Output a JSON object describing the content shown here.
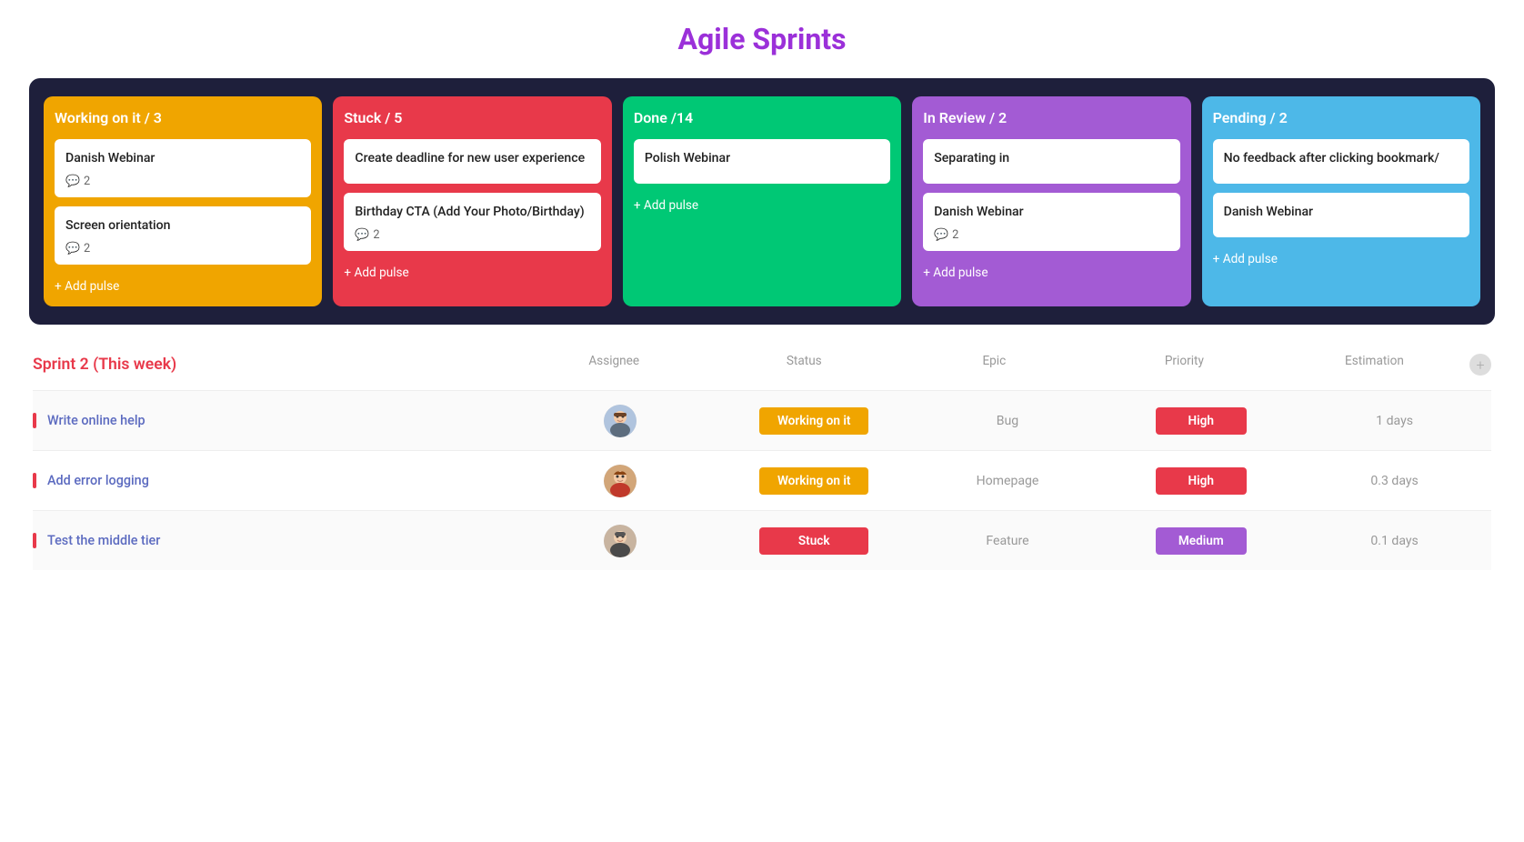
{
  "pageTitle": "Agile Sprints",
  "kanban": {
    "columns": [
      {
        "id": "working-on-it",
        "title": "Working on it / 3",
        "colorClass": "orange",
        "cards": [
          {
            "id": "c1",
            "title": "Danish Webinar",
            "comments": 2
          },
          {
            "id": "c2",
            "title": "Screen orientation",
            "comments": 2
          }
        ],
        "addPulse": "+ Add pulse"
      },
      {
        "id": "stuck",
        "title": "Stuck / 5",
        "colorClass": "red",
        "cards": [
          {
            "id": "c3",
            "title": "Create deadline for new user experience",
            "comments": null
          },
          {
            "id": "c4",
            "title": "Birthday CTA (Add Your Photo/Birthday)",
            "comments": 2
          }
        ],
        "addPulse": "+ Add pulse"
      },
      {
        "id": "done",
        "title": "Done /14",
        "colorClass": "green",
        "cards": [
          {
            "id": "c5",
            "title": "Polish Webinar",
            "comments": null
          }
        ],
        "addPulse": "+ Add pulse"
      },
      {
        "id": "in-review",
        "title": "In Review / 2",
        "colorClass": "purple",
        "cards": [
          {
            "id": "c6",
            "title": "Separating in",
            "comments": null
          },
          {
            "id": "c7",
            "title": "Danish Webinar",
            "comments": 2
          }
        ],
        "addPulse": "+ Add pulse"
      },
      {
        "id": "pending",
        "title": "Pending / 2",
        "colorClass": "blue",
        "cards": [
          {
            "id": "c8",
            "title": "No feedback after clicking bookmark/",
            "comments": null
          },
          {
            "id": "c9",
            "title": "Danish Webinar",
            "comments": null
          }
        ],
        "addPulse": "+ Add pulse"
      }
    ]
  },
  "sprint": {
    "title": "Sprint 2 (This week)",
    "columns": {
      "assignee": "Assignee",
      "status": "Status",
      "epic": "Epic",
      "priority": "Priority",
      "estimation": "Estimation"
    },
    "addIcon": "+",
    "rows": [
      {
        "id": "r1",
        "task": "Write online help",
        "avatarLabel": "avatar-male-1",
        "avatarEmoji": "👨",
        "statusLabel": "Working on it",
        "statusClass": "status-orange",
        "epic": "Bug",
        "priorityLabel": "High",
        "priorityClass": "priority-red",
        "estimation": "1 days"
      },
      {
        "id": "r2",
        "task": "Add error logging",
        "avatarLabel": "avatar-female-1",
        "avatarEmoji": "👩",
        "statusLabel": "Working on it",
        "statusClass": "status-orange",
        "epic": "Homepage",
        "priorityLabel": "High",
        "priorityClass": "priority-red",
        "estimation": "0.3 days"
      },
      {
        "id": "r3",
        "task": "Test the middle tier",
        "avatarLabel": "avatar-male-2",
        "avatarEmoji": "👨",
        "statusLabel": "Stuck",
        "statusClass": "status-red",
        "epic": "Feature",
        "priorityLabel": "Medium",
        "priorityClass": "priority-purple",
        "estimation": "0.1 days"
      }
    ]
  }
}
